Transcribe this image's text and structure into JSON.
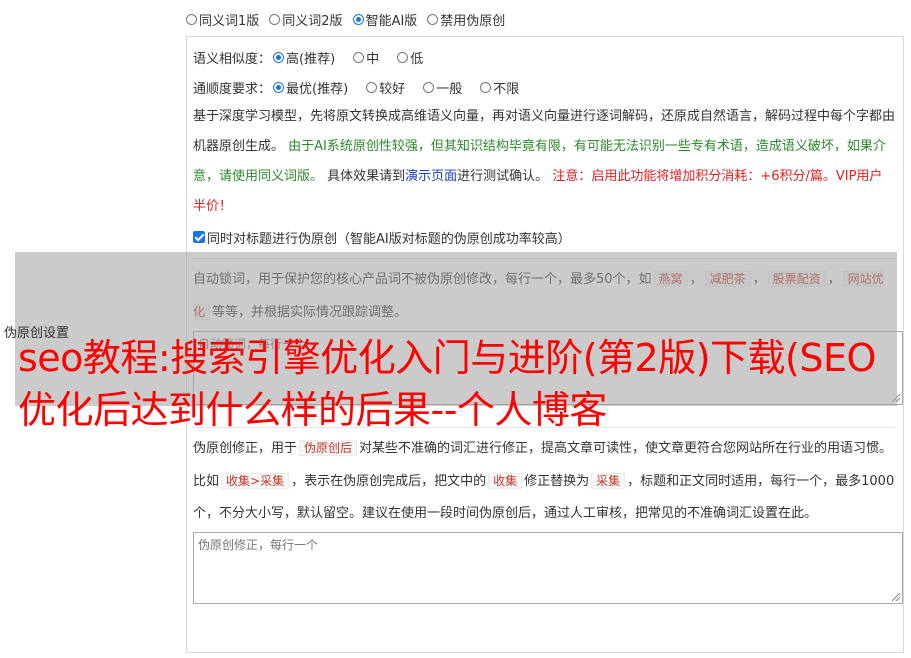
{
  "top_options": [
    {
      "label": "同义词1版",
      "checked": false
    },
    {
      "label": "同义词2版",
      "checked": false
    },
    {
      "label": "智能AI版",
      "checked": true
    },
    {
      "label": "禁用伪原创",
      "checked": false
    }
  ],
  "similarity": {
    "label": "语义相似度：",
    "options": [
      {
        "label": "高(推荐)",
        "checked": true
      },
      {
        "label": "中",
        "checked": false
      },
      {
        "label": "低",
        "checked": false
      }
    ]
  },
  "fluency": {
    "label": "通顺度要求：",
    "options": [
      {
        "label": "最优(推荐)",
        "checked": true
      },
      {
        "label": "较好",
        "checked": false
      },
      {
        "label": "一般",
        "checked": false
      },
      {
        "label": "不限",
        "checked": false
      }
    ]
  },
  "ai_desc": {
    "part1": "基于深度学习模型，先将原文转换成高维语义向量，再对语义向量进行逐词解码，还原成自然语言，解码过程中每个字都由机器原创生成。 ",
    "part2": "由于AI系统原创性较强，但其知识结构毕竟有限，有可能无法识别一些专有术语，造成语义破坏，如果介意，请使用同义词版。",
    "part3": " 具体效果请到",
    "link": "演示页面",
    "part4": "进行测试确认。 ",
    "part5": "注意：启用此功能将增加积分消耗：+6积分/篇。VIP用户半价！"
  },
  "title_checkbox": {
    "label": "同时对标题进行伪原创（智能AI版对标题的伪原创成功率较高）",
    "checked": true
  },
  "lock_words": {
    "desc_before": "自动锁词，用于保护您的核心产品词不被伪原创修改，每行一个，最多50个，如",
    "tags": [
      "燕窝",
      "减肥茶",
      "股票配资",
      "网站优化"
    ],
    "desc_after": "等等，并根据实际情况跟踪调整。",
    "placeholder": "自动锁词，每行一个"
  },
  "correction": {
    "desc1": "伪原创修正，用于",
    "tag1": "伪原创后",
    "desc2": "对某些不准确的词汇进行修正，提高文章可读性，使文章更符合您网站所在行业的用语习惯。比如",
    "tag2": "收集>采集",
    "desc3": "，表示在伪原创完成后，把文中的",
    "tag3": "收集",
    "desc4": "修正替换为",
    "tag4": "采集",
    "desc5": "，标题和正文同时适用，每行一个，最多1000个，不分大小写，默认留空。建议在使用一段时间伪原创后，通过人工审核，把常见的不准确词汇设置在此。",
    "placeholder": "伪原创修正，每行一个"
  },
  "side_label": "伪原创设置",
  "headline": "seo教程:搜索引擎优化入门与进阶(第2版)下载(SEO优化后达到什么样的后果--个人博客"
}
